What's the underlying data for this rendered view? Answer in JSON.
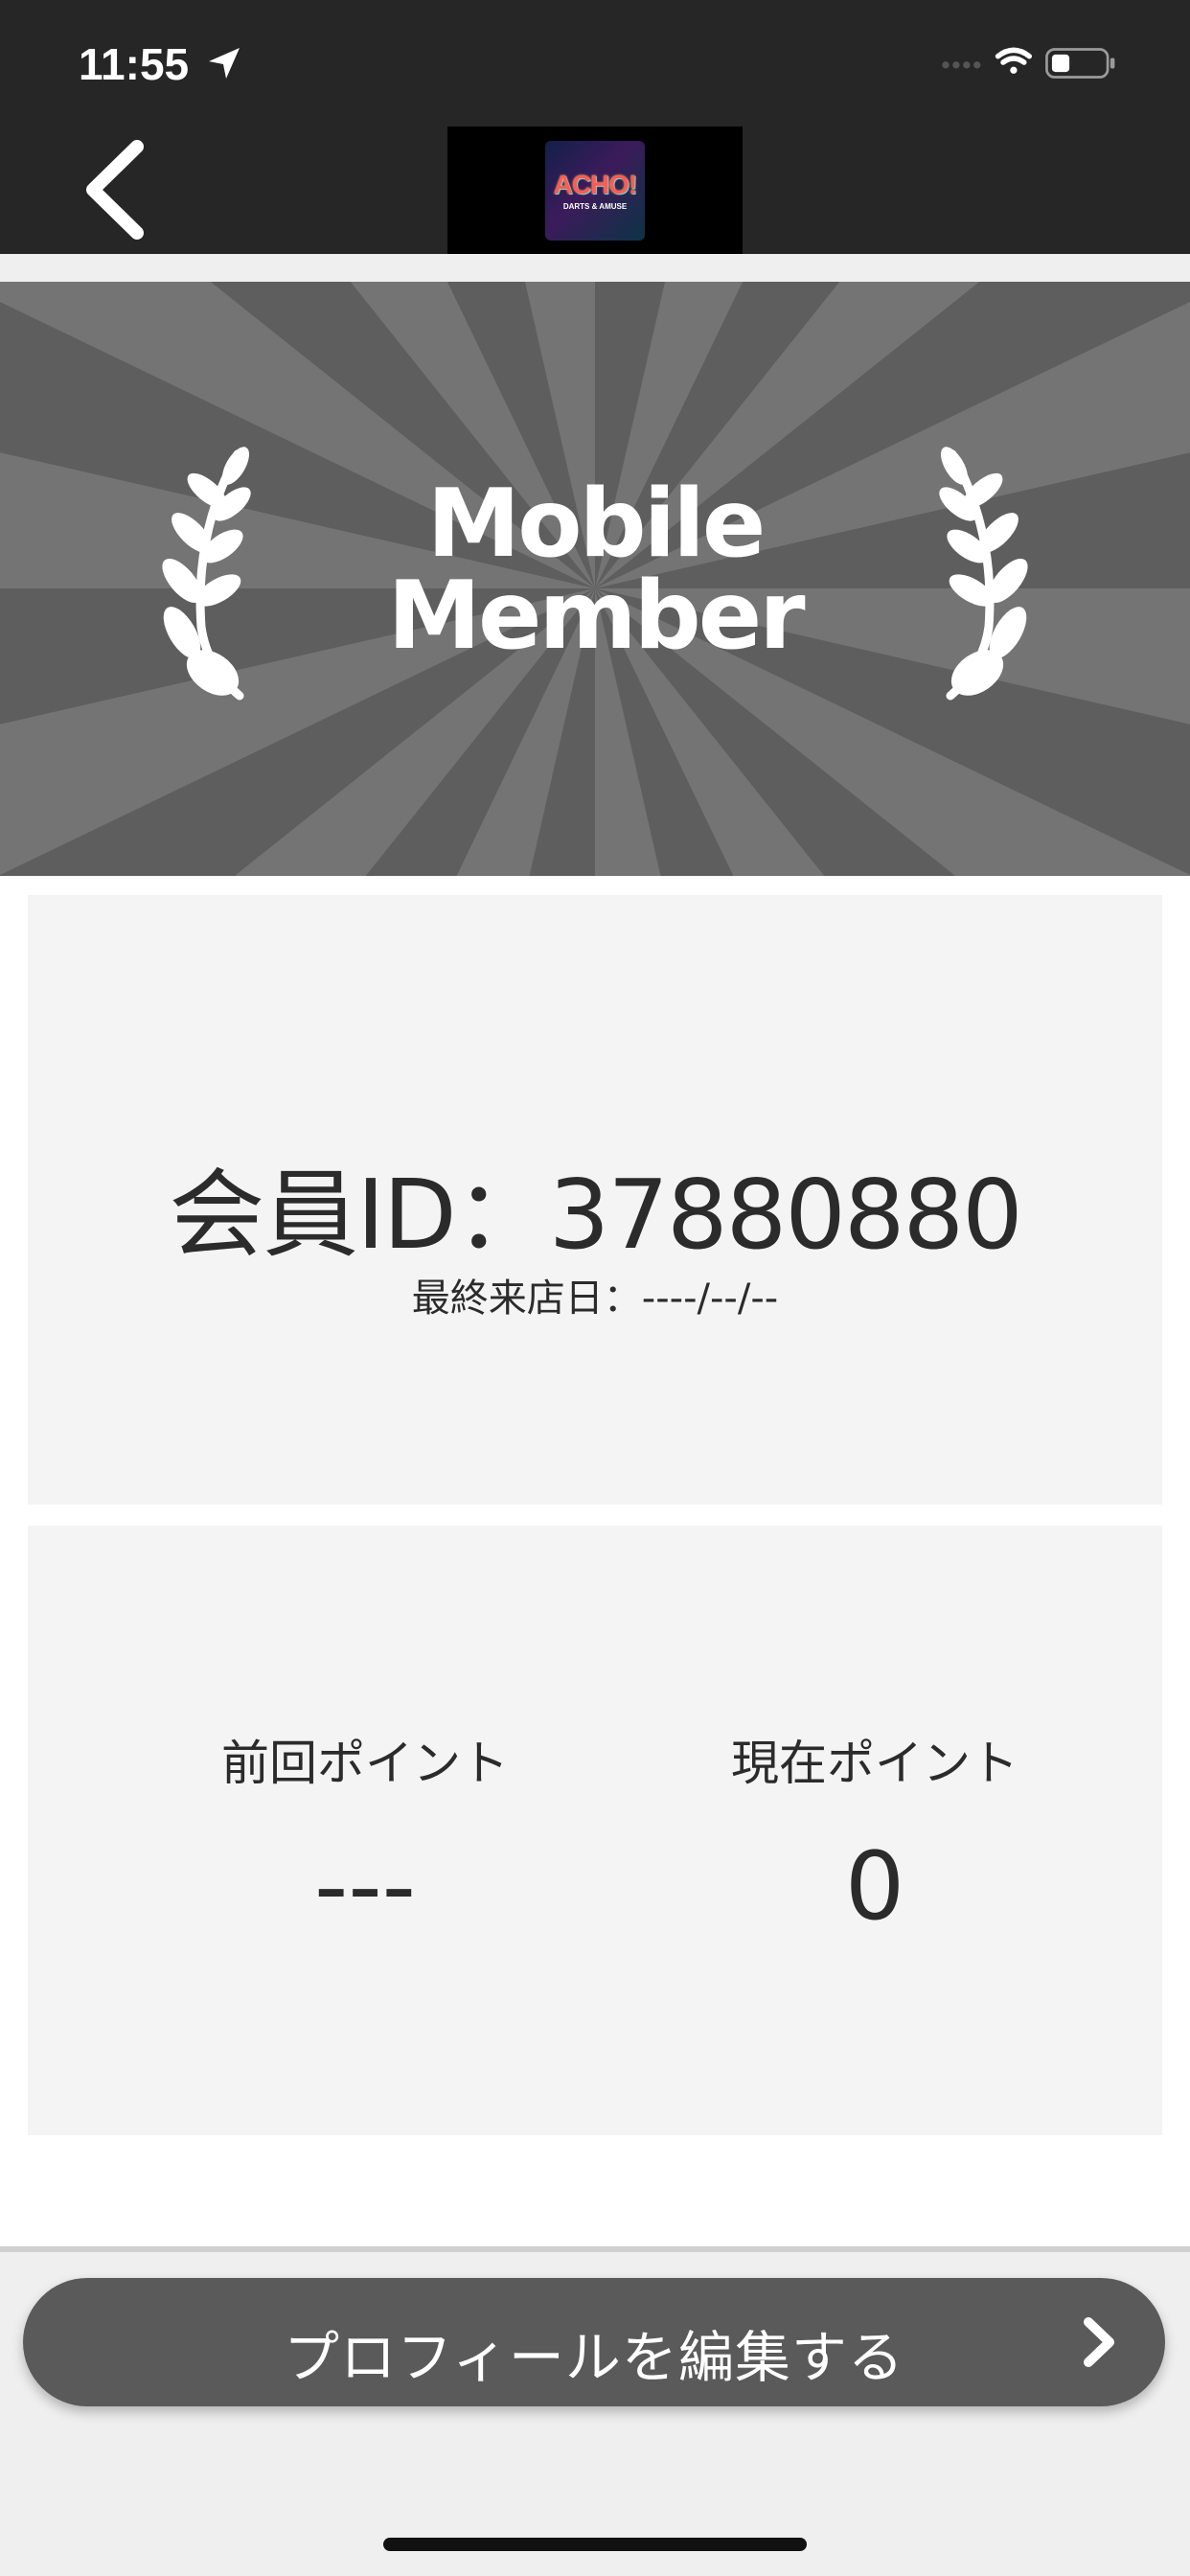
{
  "status_bar": {
    "time": "11:55",
    "icons": [
      "location-arrow-icon",
      "cellular-signal-icon",
      "wifi-icon",
      "battery-icon"
    ]
  },
  "nav": {
    "back_icon": "chevron-left-icon",
    "logo": {
      "text": "ACHO!",
      "subtitle": "DARTS & AMUSE"
    }
  },
  "banner": {
    "title_line1": "Mobile",
    "title_line2": "Member",
    "decoration": "laurel-icon"
  },
  "member": {
    "id_text": "会員ID：37880880",
    "last_visit": "最終来店日：----/--/--"
  },
  "points": {
    "previous_label": "前回ポイント",
    "previous_value": "---",
    "current_label": "現在ポイント",
    "current_value": "0"
  },
  "actions": {
    "edit_profile_label": "プロフィールを編集する",
    "edit_profile_icon": "chevron-right-icon"
  },
  "colors": {
    "header_bg": "#262626",
    "banner_bg": "#5e5e5e",
    "banner_ray": "#747474",
    "card_bg": "#f4f4f4",
    "button_bg": "#5a5a5a"
  }
}
